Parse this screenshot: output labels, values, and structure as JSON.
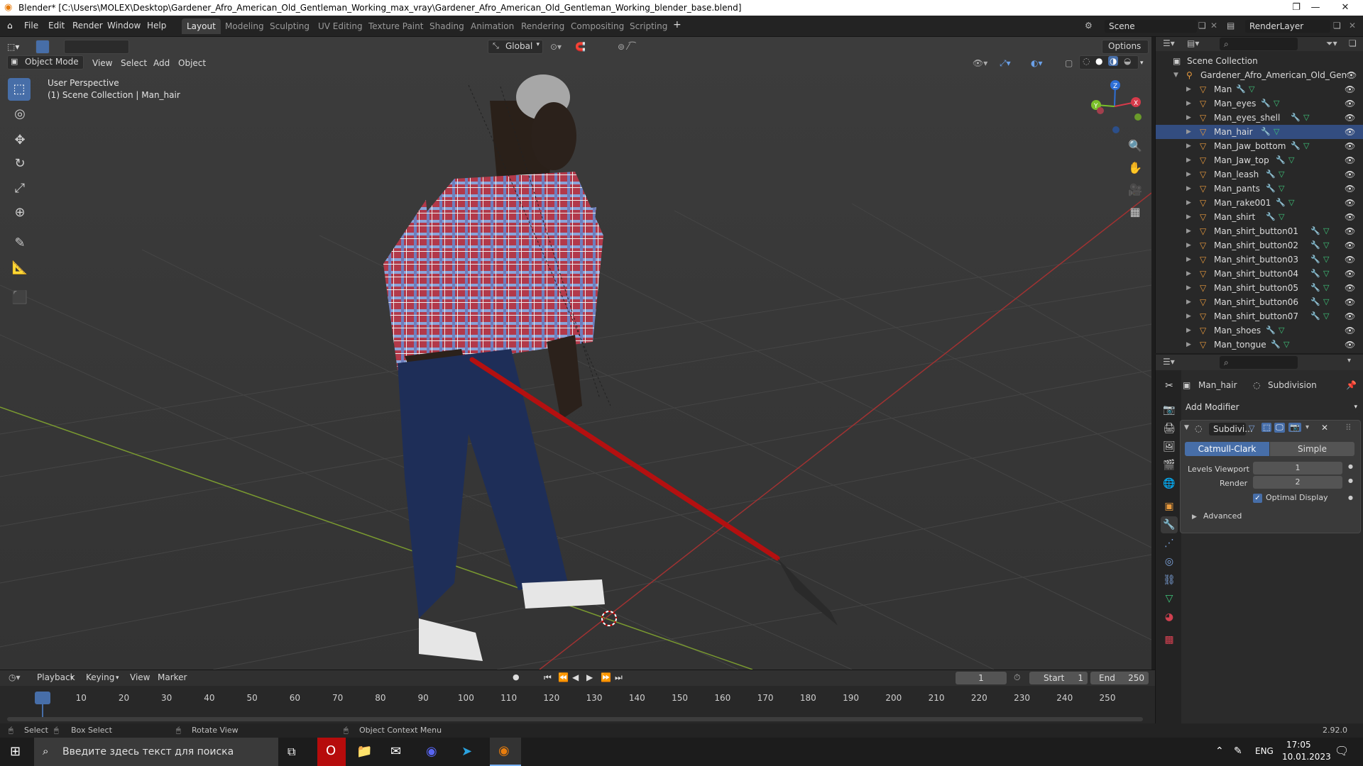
{
  "window": {
    "title": "Blender* [C:\\Users\\MOLEX\\Desktop\\Gardener_Afro_American_Old_Gentleman_Working_max_vray\\Gardener_Afro_American_Old_Gentleman_Working_blender_base.blend]"
  },
  "menubar": {
    "menus": [
      "File",
      "Edit",
      "Render",
      "Window",
      "Help"
    ],
    "workspaces": [
      "Layout",
      "Modeling",
      "Sculpting",
      "UV Editing",
      "Texture Paint",
      "Shading",
      "Animation",
      "Rendering",
      "Compositing",
      "Scripting"
    ],
    "active_workspace": "Layout",
    "add_label": "+",
    "scene": "Scene",
    "view_layer": "RenderLayer"
  },
  "viewport_header": {
    "mode": "Object Mode",
    "menus": [
      "View",
      "Select",
      "Add",
      "Object"
    ],
    "transform_orientation": "Global",
    "options_label": "Options"
  },
  "viewport": {
    "view_name": "User Perspective",
    "collection_info": "(1) Scene Collection | Man_hair",
    "axis_labels": {
      "x": "X",
      "y": "Y",
      "z": "Z"
    }
  },
  "outliner": {
    "root": "Scene Collection",
    "collection": "Gardener_Afro_American_Old_Gentle",
    "objects": [
      "Man",
      "Man_eyes",
      "Man_eyes_shell",
      "Man_hair",
      "Man_Jaw_bottom",
      "Man_Jaw_top",
      "Man_leash",
      "Man_pants",
      "Man_rake001",
      "Man_shirt",
      "Man_shirt_button01",
      "Man_shirt_button02",
      "Man_shirt_button03",
      "Man_shirt_button04",
      "Man_shirt_button05",
      "Man_shirt_button06",
      "Man_shirt_button07",
      "Man_shoes",
      "Man_tongue"
    ],
    "selected": "Man_hair"
  },
  "properties": {
    "object_name": "Man_hair",
    "modifier_tab": "Subdivision",
    "add_modifier": "Add Modifier",
    "modifier_short_name": "Subdivi...",
    "types": [
      "Catmull-Clark",
      "Simple"
    ],
    "active_type": "Catmull-Clark",
    "levels_viewport_label": "Levels Viewport",
    "levels_viewport": "1",
    "render_label": "Render",
    "render": "2",
    "optimal_display": "Optimal Display",
    "advanced": "Advanced"
  },
  "timeline": {
    "menus": [
      "Playback",
      "Keying",
      "View",
      "Marker"
    ],
    "current_frame": "1",
    "start_label": "Start",
    "start": "1",
    "end_label": "End",
    "end": "250",
    "ticks": [
      "1",
      "10",
      "20",
      "30",
      "40",
      "50",
      "60",
      "70",
      "80",
      "90",
      "100",
      "110",
      "120",
      "130",
      "140",
      "150",
      "160",
      "170",
      "180",
      "190",
      "200",
      "210",
      "220",
      "230",
      "240",
      "250"
    ]
  },
  "statusbar": {
    "select": "Select",
    "box_select": "Box Select",
    "rotate_view": "Rotate View",
    "context_menu": "Object Context Menu",
    "version": "2.92.0"
  },
  "taskbar": {
    "search_placeholder": "Введите здесь текст для поиска",
    "language": "ENG",
    "time": "17:05",
    "date": "10.01.2023"
  }
}
